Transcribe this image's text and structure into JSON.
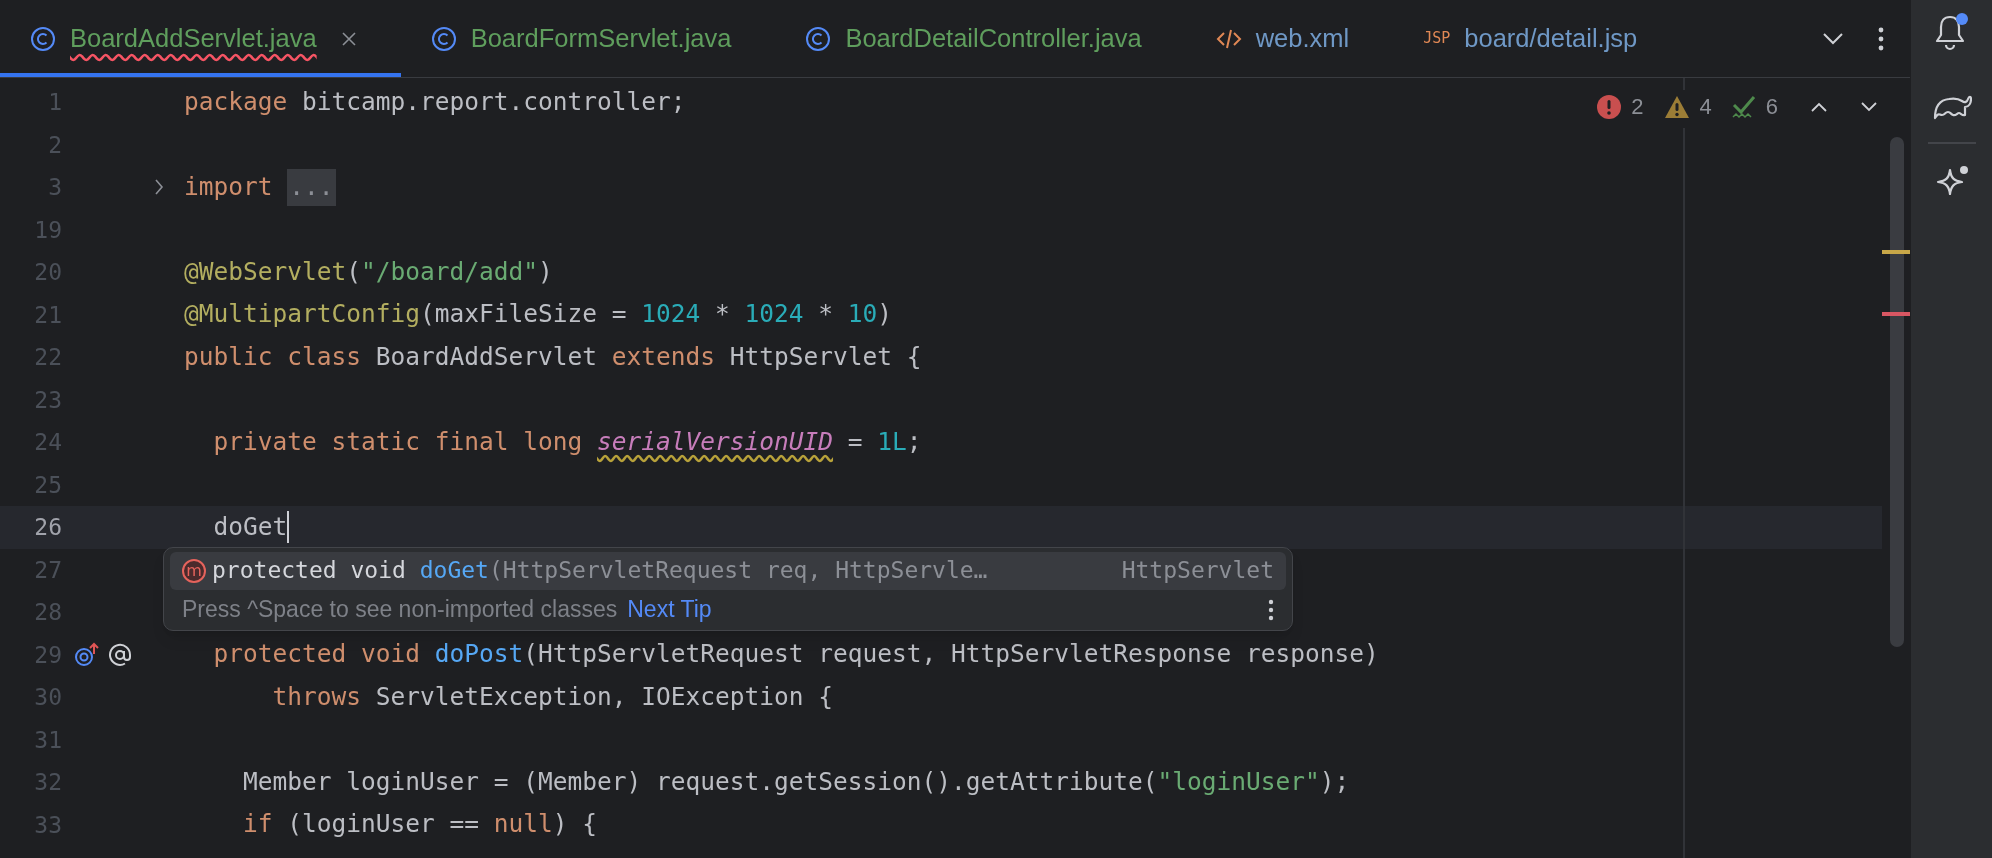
{
  "tabs": [
    {
      "label": "BoardAddServlet.java",
      "kind": "class",
      "selected": true,
      "has_errors": true,
      "color": "#5f9e5d"
    },
    {
      "label": "BoardFormServlet.java",
      "kind": "class",
      "selected": false,
      "has_errors": false,
      "color": "#5f9e5d"
    },
    {
      "label": "BoardDetailController.java",
      "kind": "class",
      "selected": false,
      "has_errors": false,
      "color": "#5f9e5d"
    },
    {
      "label": "web.xml",
      "kind": "xml",
      "selected": false,
      "has_errors": false,
      "color": "#6f98c6"
    },
    {
      "label": "board/detail.jsp",
      "kind": "jsp",
      "selected": false,
      "has_errors": false,
      "color": "#6f98c6"
    }
  ],
  "tab_jsp_icon_text": "JSP",
  "inspections": {
    "errors": "2",
    "warnings": "4",
    "weak_warnings": "6"
  },
  "lines": [
    {
      "number": "1",
      "tokens": [
        {
          "kind": "keyword",
          "text": "package "
        },
        {
          "kind": "plain",
          "text": "bitcamp.report.controller;"
        }
      ]
    },
    {
      "number": "2"
    },
    {
      "number": "3",
      "folded": true,
      "tokens": [
        {
          "kind": "keyword",
          "text": "import "
        },
        {
          "kind": "fold",
          "text": "..."
        }
      ]
    },
    {
      "number": "19"
    },
    {
      "number": "20",
      "tokens": [
        {
          "kind": "annotation",
          "text": "@WebServlet"
        },
        {
          "kind": "plain",
          "text": "("
        },
        {
          "kind": "string",
          "text": "\"/board/add\""
        },
        {
          "kind": "plain",
          "text": ")"
        }
      ]
    },
    {
      "number": "21",
      "tokens": [
        {
          "kind": "annotation",
          "text": "@MultipartConfig"
        },
        {
          "kind": "plain",
          "text": "(maxFileSize = "
        },
        {
          "kind": "number",
          "text": "1024"
        },
        {
          "kind": "plain",
          "text": " * "
        },
        {
          "kind": "number",
          "text": "1024"
        },
        {
          "kind": "plain",
          "text": " * "
        },
        {
          "kind": "number",
          "text": "10"
        },
        {
          "kind": "plain",
          "text": ")"
        }
      ]
    },
    {
      "number": "22",
      "tokens": [
        {
          "kind": "keyword",
          "text": "public class "
        },
        {
          "kind": "plain",
          "text": "BoardAddServlet "
        },
        {
          "kind": "keyword",
          "text": "extends "
        },
        {
          "kind": "plain",
          "text": "HttpServlet {"
        }
      ]
    },
    {
      "number": "23"
    },
    {
      "number": "24",
      "tokens": [
        {
          "kind": "keyword",
          "text": "  private static final long "
        },
        {
          "kind": "field",
          "text": "serialVersionUID"
        },
        {
          "kind": "plain",
          "text": " = "
        },
        {
          "kind": "number",
          "text": "1L"
        },
        {
          "kind": "plain",
          "text": ";"
        }
      ]
    },
    {
      "number": "25"
    },
    {
      "number": "26",
      "current": true,
      "tokens": [
        {
          "kind": "plain",
          "text": "  doGet"
        }
      ]
    },
    {
      "number": "27"
    },
    {
      "number": "28"
    },
    {
      "number": "29",
      "gutter_icons": true,
      "tokens": [
        {
          "kind": "keyword",
          "text": "  protected void "
        },
        {
          "kind": "method",
          "text": "doPost"
        },
        {
          "kind": "plain",
          "text": "(HttpServletRequest request, HttpServletResponse response)"
        }
      ]
    },
    {
      "number": "30",
      "tokens": [
        {
          "kind": "keyword",
          "text": "      throws "
        },
        {
          "kind": "plain",
          "text": "ServletException, IOException {"
        }
      ]
    },
    {
      "number": "31"
    },
    {
      "number": "32",
      "tokens": [
        {
          "kind": "plain",
          "text": "    Member loginUser = (Member) request.getSession().getAttribute("
        },
        {
          "kind": "string",
          "text": "\"loginUser\""
        },
        {
          "kind": "plain",
          "text": ");"
        }
      ]
    },
    {
      "number": "33",
      "tokens": [
        {
          "kind": "keyword",
          "text": "    if "
        },
        {
          "kind": "plain",
          "text": "(loginUser == "
        },
        {
          "kind": "keyword",
          "text": "null"
        },
        {
          "kind": "plain",
          "text": ") {"
        }
      ]
    }
  ],
  "completion": {
    "items": [
      {
        "icon_letter": "m",
        "selected": true,
        "modifiers": "protected void ",
        "name": "doGet",
        "params": "(HttpServletRequest req, HttpServle…",
        "type": "HttpServlet"
      }
    ],
    "hint": "Press ^Space to see non-imported classes",
    "hint_link": "Next Tip"
  }
}
